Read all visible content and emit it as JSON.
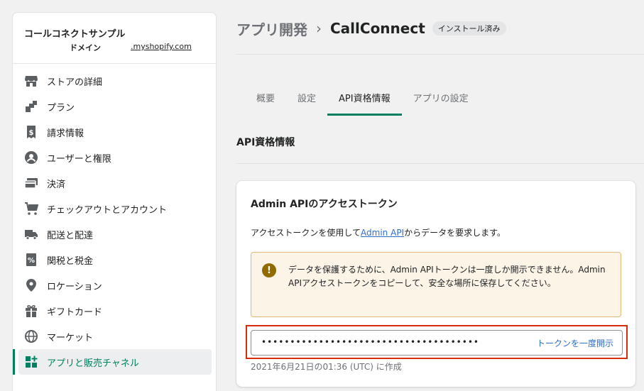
{
  "store": {
    "name": "コールコネクトサンプル",
    "domain_label": "ドメイン",
    "domain_url": ".myshopify.com"
  },
  "nav": [
    {
      "label": "ストアの詳細",
      "icon": "store-icon"
    },
    {
      "label": "プラン",
      "icon": "plan-icon"
    },
    {
      "label": "請求情報",
      "icon": "billing-icon"
    },
    {
      "label": "ユーザーと権限",
      "icon": "user-icon"
    },
    {
      "label": "決済",
      "icon": "payment-icon"
    },
    {
      "label": "チェックアウトとアカウント",
      "icon": "cart-icon"
    },
    {
      "label": "配送と配達",
      "icon": "truck-icon"
    },
    {
      "label": "関税と税金",
      "icon": "tax-icon"
    },
    {
      "label": "ロケーション",
      "icon": "location-icon"
    },
    {
      "label": "ギフトカード",
      "icon": "gift-icon"
    },
    {
      "label": "マーケット",
      "icon": "globe-icon"
    },
    {
      "label": "アプリと販売チャネル",
      "icon": "apps-icon"
    }
  ],
  "header": {
    "breadcrumb": "アプリ開発",
    "title": "CallConnect",
    "badge": "インストール済み"
  },
  "tabs": [
    "概要",
    "設定",
    "API資格情報",
    "アプリの設定"
  ],
  "section_title": "API資格情報",
  "card": {
    "title": "Admin APIのアクセストークン",
    "desc_before": "アクセストークンを使用して",
    "desc_link": "Admin API",
    "desc_after": "からデータを要求します。",
    "banner_text": "データを保護するために、Admin APIトークンは一度しか開示できません。Admin APIアクセストークンをコピーして、安全な場所に保存してください。",
    "token_mask": "••••••••••••••••••••••••••••••••••••••",
    "reveal_label": "トークンを一度開示",
    "created_text": "2021年6月21日の01:36 (UTC) に作成"
  },
  "colors": {
    "accent": "#008060",
    "link": "#2c6ecb",
    "warning_bg": "#fdf4e8",
    "highlight": "#d72c0d"
  }
}
